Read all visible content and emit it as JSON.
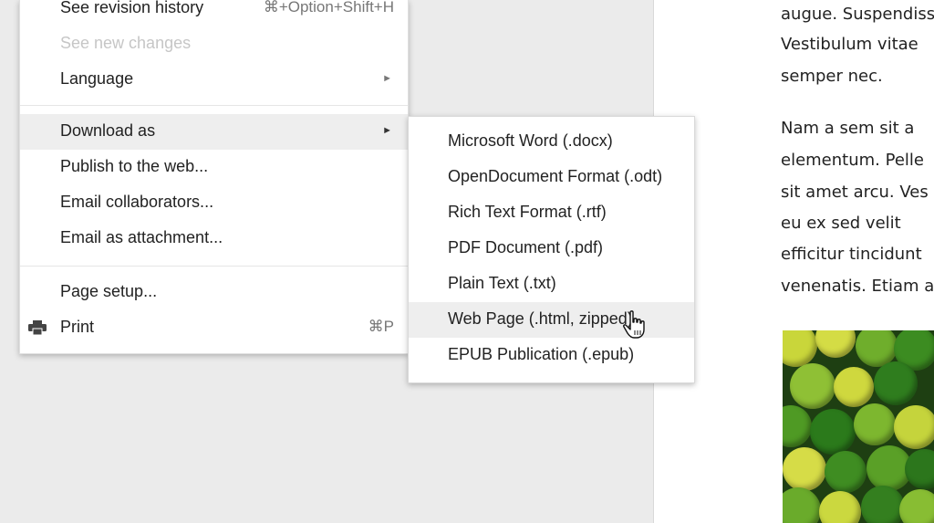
{
  "file_menu": {
    "items": [
      {
        "label": "See revision history",
        "shortcut": "⌘+Option+Shift+H"
      },
      {
        "label": "See new changes"
      },
      {
        "label": "Language",
        "arrow": "►"
      },
      {
        "label": "Download as",
        "arrow": "►"
      },
      {
        "label": "Publish to the web..."
      },
      {
        "label": "Email collaborators..."
      },
      {
        "label": "Email as attachment..."
      },
      {
        "label": "Page setup..."
      },
      {
        "label": "Print",
        "shortcut": "⌘P",
        "icon": "printer-icon"
      }
    ]
  },
  "download_submenu": {
    "items": [
      {
        "label": "Microsoft Word (.docx)"
      },
      {
        "label": "OpenDocument Format (.odt)"
      },
      {
        "label": "Rich Text Format (.rtf)"
      },
      {
        "label": "PDF Document (.pdf)"
      },
      {
        "label": "Plain Text (.txt)"
      },
      {
        "label": "Web Page (.html, zipped)"
      },
      {
        "label": "EPUB Publication (.epub)"
      }
    ]
  },
  "document": {
    "lines": [
      "augue. Suspendisse",
      "Vestibulum vitae",
      "semper nec.",
      "Nam a sem sit a",
      "elementum. Pelle",
      "sit amet arcu. Ves",
      "eu ex sed velit",
      "efficitur tincidunt",
      "venenatis. Etiam a"
    ]
  }
}
